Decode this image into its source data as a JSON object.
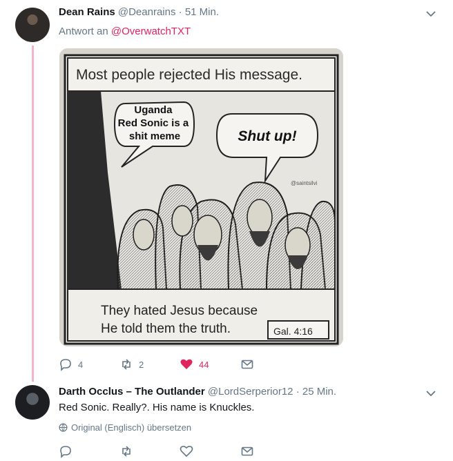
{
  "tweet1": {
    "display_name": "Dean Rains",
    "handle": "@Deanrains",
    "separator": " · ",
    "time": "51 Min.",
    "reply_prefix": "Antwort an ",
    "reply_to": "@OverwatchTXT",
    "image": {
      "caption_top": "Most people rejected His message.",
      "bubble_left": [
        "Uganda",
        "Red Sonic is a",
        "shit meme"
      ],
      "bubble_right": "Shut up!",
      "watermark": "@saintsilvi",
      "caption_bottom_1": "They hated Jesus because",
      "caption_bottom_2": "He told them the truth.",
      "reference": "Gal. 4:16"
    },
    "replies": "4",
    "retweets": "2",
    "likes": "44",
    "liked": true
  },
  "tweet2": {
    "display_name": "Darth Occlus – The Outlander",
    "handle": "@LordSerperior12",
    "separator": " · ",
    "time": "25 Min.",
    "text": "Red Sonic. Really?. His name is Knuckles.",
    "translate_label": "Original (Englisch) übersetzen"
  },
  "colors": {
    "like_active": "#e0245e",
    "icon_gray": "#657786",
    "thread_line": "#f4b4c7"
  }
}
